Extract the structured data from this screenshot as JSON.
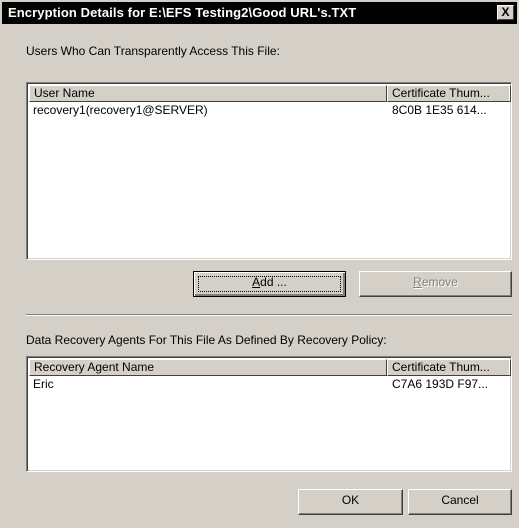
{
  "window": {
    "title": "Encryption Details for E:\\EFS Testing2\\Good URL's.TXT",
    "close_glyph": "X"
  },
  "users_section": {
    "label": "Users Who Can Transparently Access This File:",
    "columns": [
      "User Name",
      "Certificate Thum..."
    ],
    "rows": [
      {
        "name": "recovery1(recovery1@SERVER)",
        "thumb": "8C0B 1E35 614..."
      }
    ]
  },
  "buttons": {
    "add_prefix": "",
    "add_mnemonic": "A",
    "add_suffix": "dd ...",
    "remove_prefix": "",
    "remove_mnemonic": "R",
    "remove_suffix": "emove",
    "ok": "OK",
    "cancel": "Cancel"
  },
  "recovery_section": {
    "label": "Data Recovery Agents For This File As Defined By Recovery Policy:",
    "columns": [
      "Recovery Agent Name",
      "Certificate Thum..."
    ],
    "rows": [
      {
        "name": "Eric",
        "thumb": "C7A6 193D F97..."
      }
    ]
  }
}
